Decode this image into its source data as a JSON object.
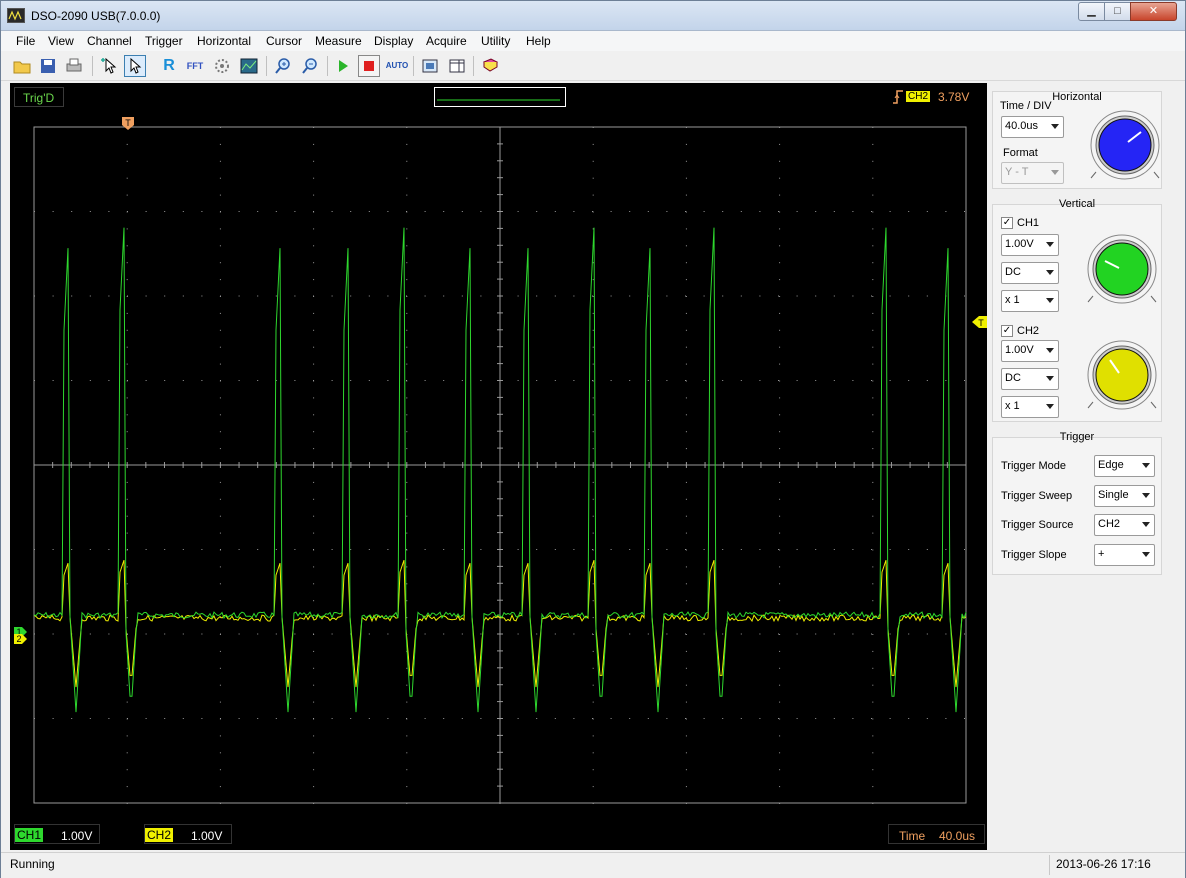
{
  "window": {
    "title": "DSO-2090 USB(7.0.0.0)",
    "min_glyph": "▁",
    "max_glyph": "□",
    "close_glyph": "✕"
  },
  "menu": [
    "File",
    "View",
    "Channel",
    "Trigger",
    "Horizontal",
    "Cursor",
    "Measure",
    "Display",
    "Acquire",
    "Utility",
    "Help"
  ],
  "toolbar": {
    "icons": [
      "open-icon",
      "save-icon",
      "print-icon",
      "cursor-select-icon",
      "pointer-icon",
      "reference-icon",
      "fft-icon",
      "math-icon",
      "display-icon",
      "zoom-in-icon",
      "zoom-out-icon",
      "run-icon",
      "stop-icon",
      "auto-icon",
      "fit-icon",
      "panel-icon",
      "help-book-icon"
    ],
    "ref_label": "R",
    "fft_label": "FFT",
    "auto_label": "AUTO"
  },
  "scope": {
    "status": "Trig'D",
    "trigger_marker": "T",
    "trigger_level_marker": "T",
    "trigger_source": "CH2",
    "trigger_level": "3.78V",
    "ch1_marker": "1",
    "ch2_marker": "2",
    "colors": {
      "ch1": "#2ed82e",
      "ch2": "#f0f000",
      "grid": "#9a9a9a",
      "orange": "#f0a060"
    }
  },
  "bottom": {
    "ch1_label": "CH1",
    "ch1_value": "1.00V",
    "ch2_label": "CH2",
    "ch2_value": "1.00V",
    "time_label": "Time",
    "time_value": "40.0us"
  },
  "panel": {
    "horizontal": {
      "title": "Horizontal",
      "timediv_label": "Time / DIV",
      "timediv_value": "40.0us",
      "format_label": "Format",
      "format_value": "Y - T",
      "knob_color": "#2525f5"
    },
    "vertical": {
      "title": "Vertical",
      "ch1": {
        "label": "CH1",
        "checked": "✓",
        "volts": "1.00V",
        "coupling": "DC",
        "probe": "x 1",
        "knob_color": "#22d322"
      },
      "ch2": {
        "label": "CH2",
        "checked": "✓",
        "volts": "1.00V",
        "coupling": "DC",
        "probe": "x 1",
        "knob_color": "#e0e000"
      }
    },
    "trigger": {
      "title": "Trigger",
      "mode_label": "Trigger Mode",
      "mode_value": "Edge",
      "sweep_label": "Trigger Sweep",
      "sweep_value": "Single",
      "source_label": "Trigger Source",
      "source_value": "CH2",
      "slope_label": "Trigger Slope",
      "slope_value": "+"
    }
  },
  "statusbar": {
    "text": "Running",
    "datetime": "2013-06-26  17:16"
  }
}
